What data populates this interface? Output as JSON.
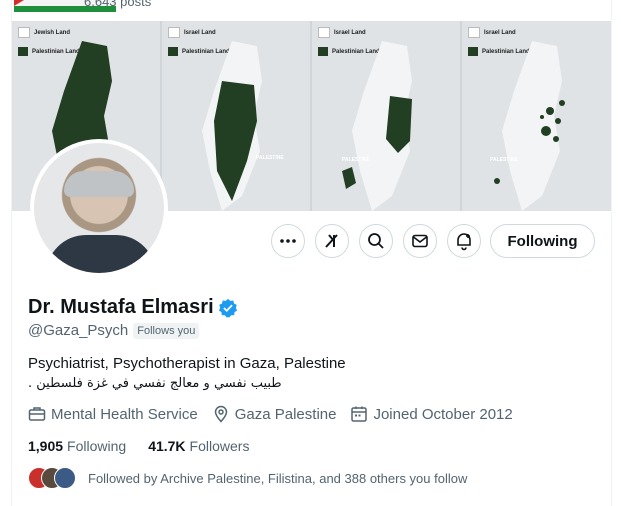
{
  "header": {
    "posts_count": "6,643 posts"
  },
  "banner": {
    "legend_jewish": "Jewish Land",
    "legend_israel": "Israel Land",
    "legend_palestinian": "Palestinian Land",
    "map_label": "PALESTINE"
  },
  "actions": {
    "follow_label": "Following",
    "icons": [
      "more-icon",
      "grok-icon",
      "search-icon",
      "message-icon",
      "notifications-icon"
    ]
  },
  "profile": {
    "name": "Dr. Mustafa Elmasri",
    "handle": "@Gaza_Psych",
    "follows_you": "Follows you",
    "bio_line1": "Psychiatrist, Psychotherapist in Gaza,  Palestine",
    "bio_line2": "طبيب نفسي و معالج نفسي في غزة فلسطين .",
    "category": "Mental Health Service",
    "location": "Gaza Palestine",
    "joined": "Joined October 2012"
  },
  "stats": {
    "following_count": "1,905",
    "following_label": "Following",
    "followers_count": "41.7K",
    "followers_label": "Followers"
  },
  "followed_by": {
    "text": "Followed by Archive Palestine, Filistina, and 388 others you follow",
    "avatar_colors": [
      "#c9302c",
      "#5a4a3e",
      "#3b5b86"
    ]
  },
  "colors": {
    "verified": "#1d9bf0",
    "map_dark": "#223e23"
  }
}
